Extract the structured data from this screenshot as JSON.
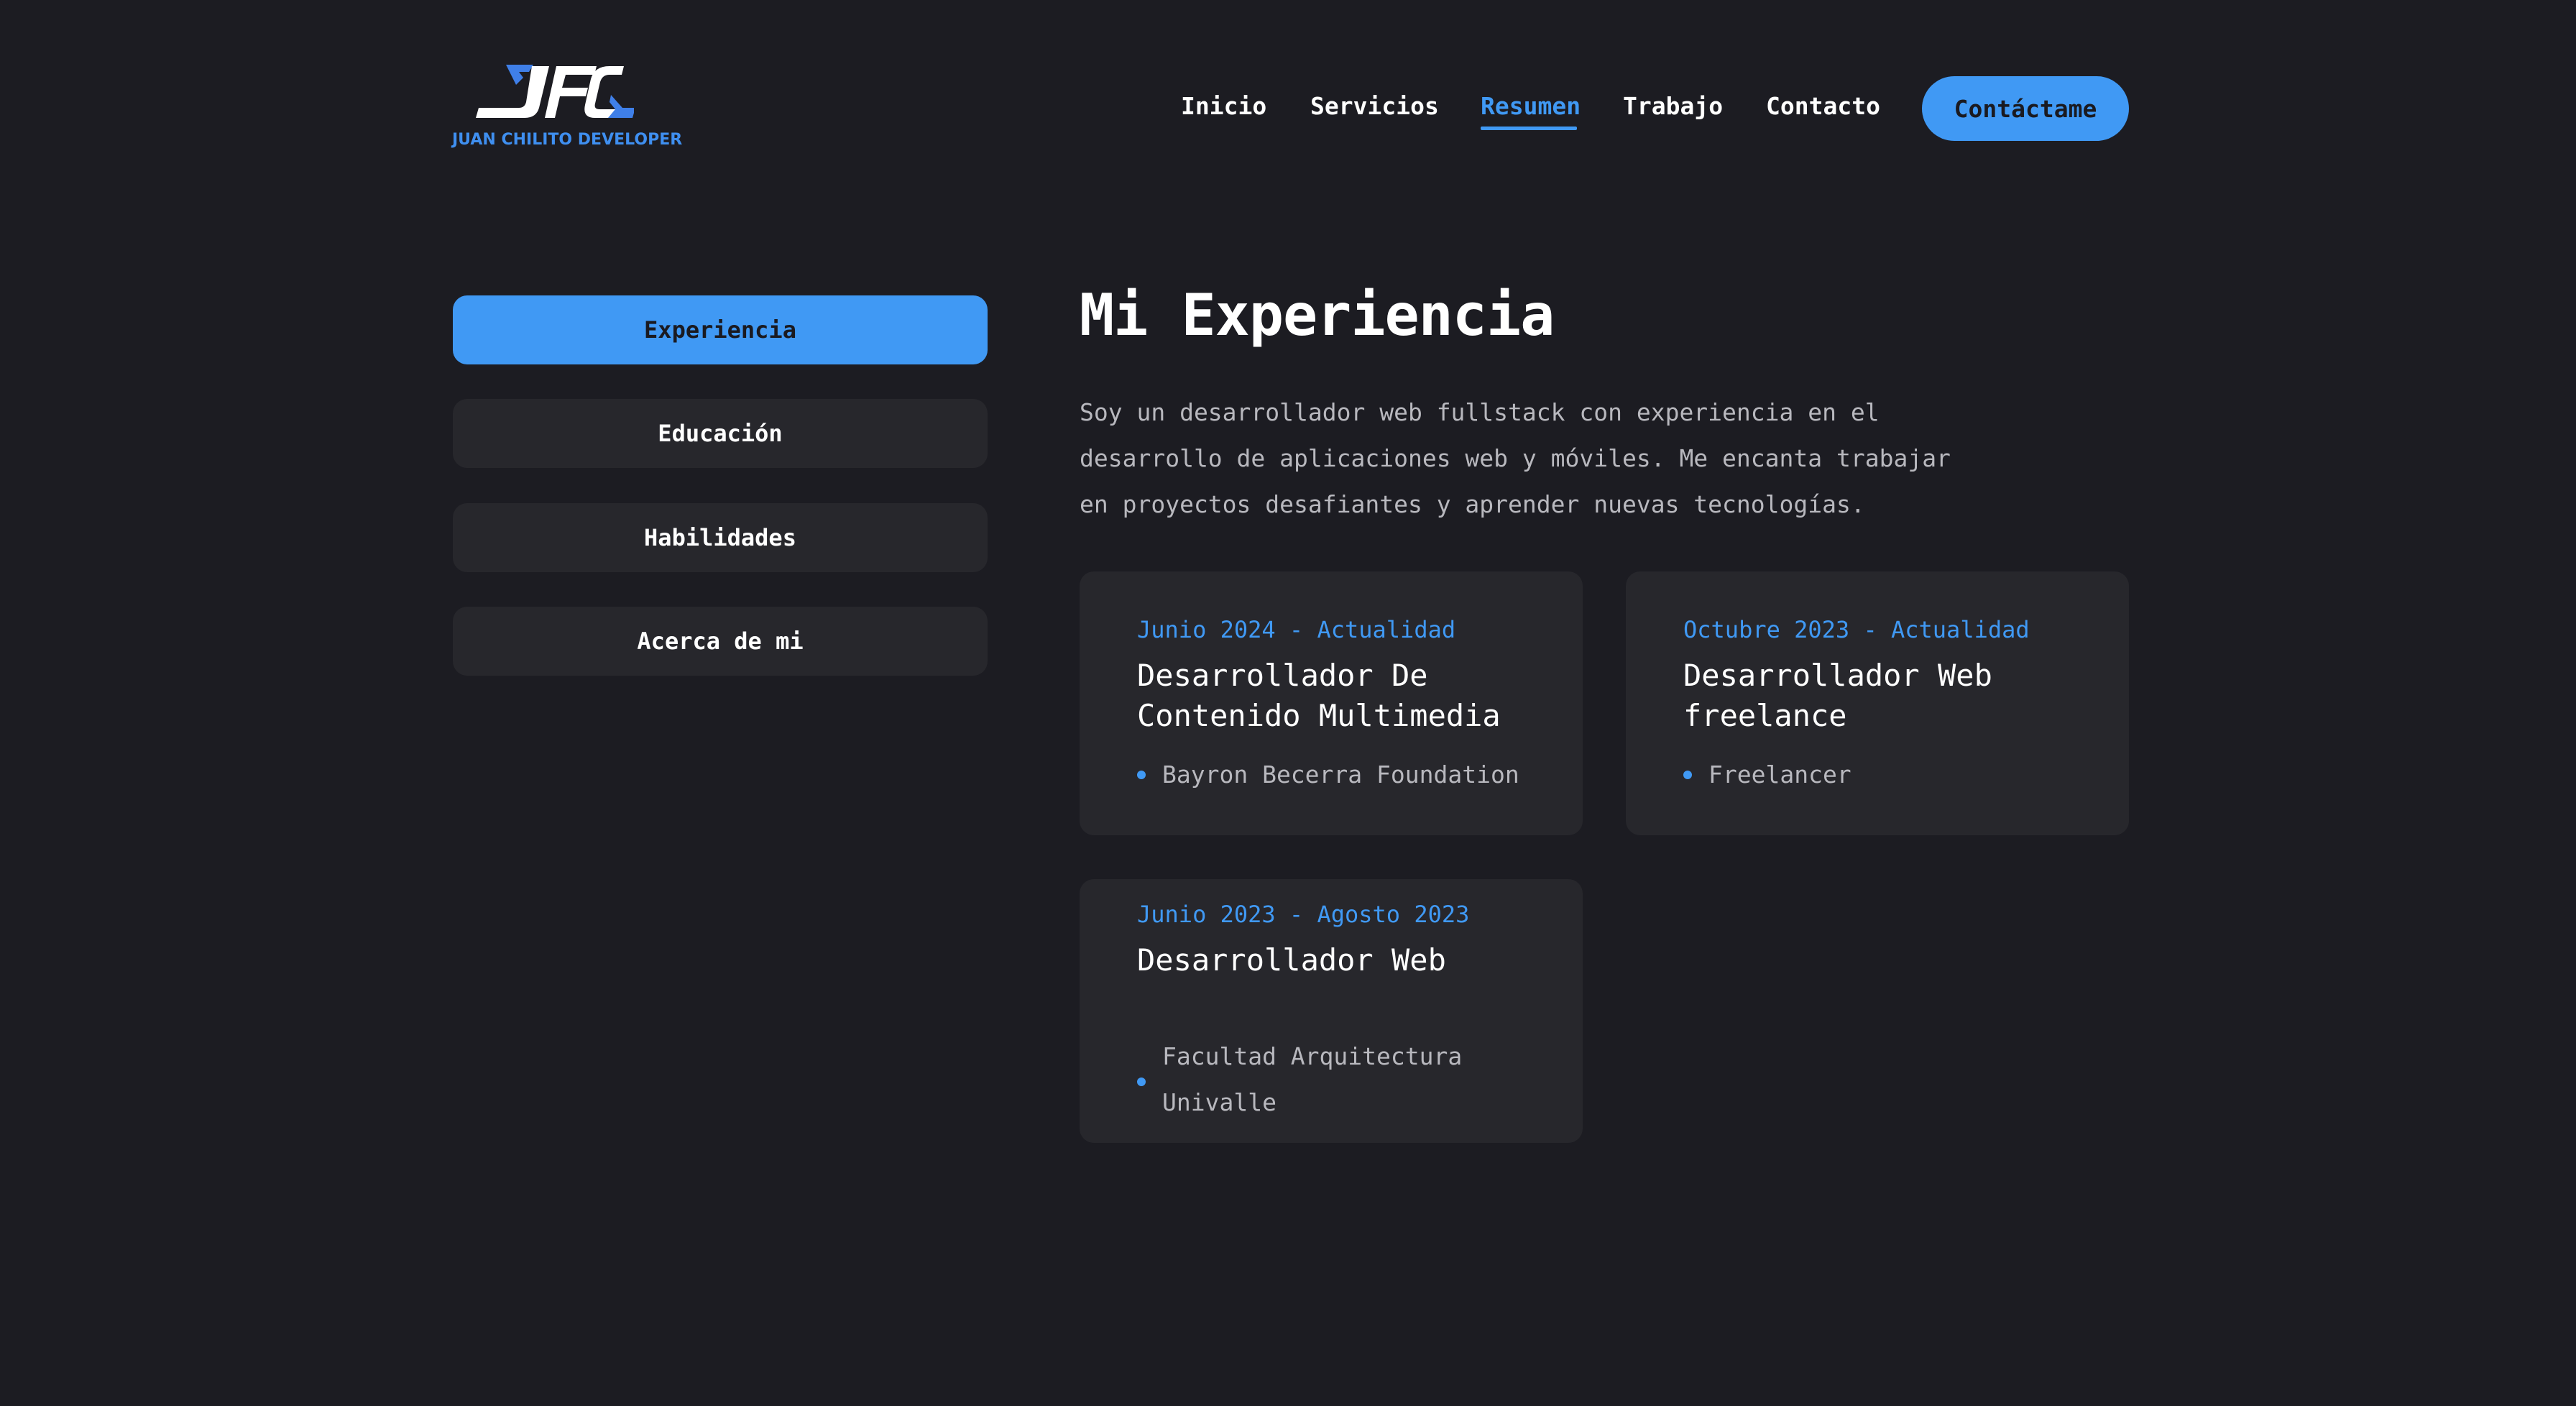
{
  "header": {
    "logo_letters": "JFC",
    "logo_subtitle": "JUAN CHILITO DEVELOPER",
    "nav": [
      {
        "label": "Inicio"
      },
      {
        "label": "Servicios"
      },
      {
        "label": "Resumen",
        "active": true
      },
      {
        "label": "Trabajo"
      },
      {
        "label": "Contacto"
      }
    ],
    "cta_label": "Contáctame"
  },
  "sidebar": {
    "items": [
      {
        "label": "Experiencia",
        "active": true
      },
      {
        "label": "Educación"
      },
      {
        "label": "Habilidades"
      },
      {
        "label": "Acerca de mi"
      }
    ]
  },
  "main": {
    "title": "Mi Experiencia",
    "description": "Soy un desarrollador web fullstack con experiencia en el desarrollo de aplicaciones web y móviles. Me encanta trabajar en proyectos desafiantes y aprender nuevas tecnologías.",
    "experiences": [
      {
        "date": "Junio 2024 - Actualidad",
        "title": "Desarrollador De Contenido Multimedia",
        "company": "Bayron Becerra Foundation"
      },
      {
        "date": "Octubre 2023 - Actualidad",
        "title": "Desarrollador Web freelance",
        "company": "Freelancer"
      },
      {
        "date": "Junio 2023 - Agosto 2023",
        "title": "Desarrollador Web",
        "company": "Facultad Arquitectura Univalle"
      }
    ]
  },
  "colors": {
    "background": "#1c1c22",
    "accent": "#4099f4",
    "card": "#27272c",
    "muted_text": "#b8b8be"
  }
}
